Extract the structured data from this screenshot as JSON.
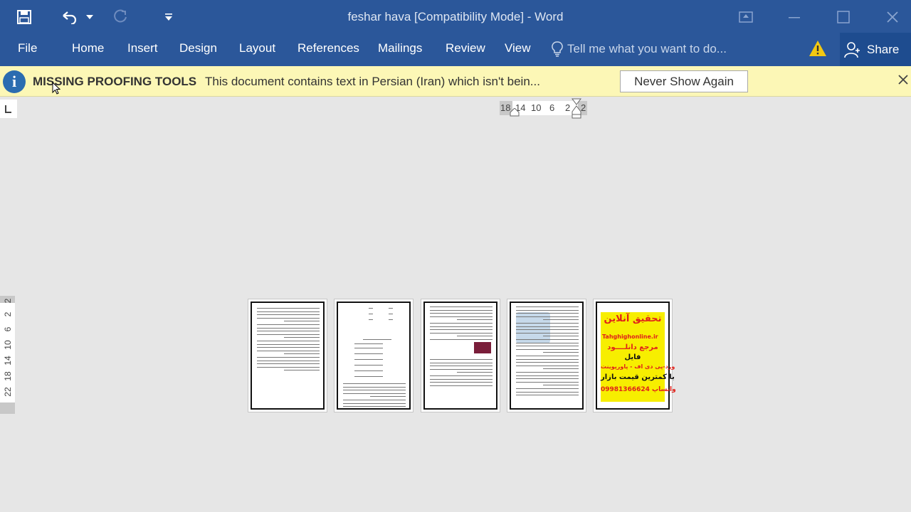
{
  "window": {
    "title": "feshar hava [Compatibility Mode] - Word"
  },
  "quick_access": {
    "icons": [
      "save-icon",
      "undo-icon",
      "undo-dropdown-icon",
      "redo-icon",
      "customize-qat-icon"
    ]
  },
  "ribbon": {
    "tabs": [
      "File",
      "Home",
      "Insert",
      "Design",
      "Layout",
      "References",
      "Mailings",
      "Review",
      "View"
    ],
    "tell_me_placeholder": "Tell me what you want to do...",
    "share_label": "Share"
  },
  "message_bar": {
    "title": "MISSING PROOFING TOOLS",
    "text": "This document contains text in Persian (Iran) which isn't bein...",
    "button_label": "Never Show Again"
  },
  "horizontal_ruler": {
    "numbers": [
      "18",
      "14",
      "10",
      "6",
      "2",
      "2"
    ]
  },
  "vertical_ruler": {
    "numbers": [
      "2",
      "2",
      "6",
      "10",
      "14",
      "18",
      "22"
    ]
  },
  "pages": {
    "count": 5,
    "ad_page": {
      "line1": "تحقیق آنلاین",
      "line2": "Tahghighonline.ir",
      "line3": "مرجع دانلــــود",
      "line4": "فایل",
      "line5": "ورد-پی دی اف - پاورپوینت",
      "line6": "با کمترین قیمت بازار",
      "line7": "09981366624 واتساپ"
    }
  },
  "colors": {
    "title_bar": "#2b579a",
    "message_bar": "#fcf7b6",
    "ad_background": "#f7ee00",
    "ad_text_red": "#e0201a"
  }
}
